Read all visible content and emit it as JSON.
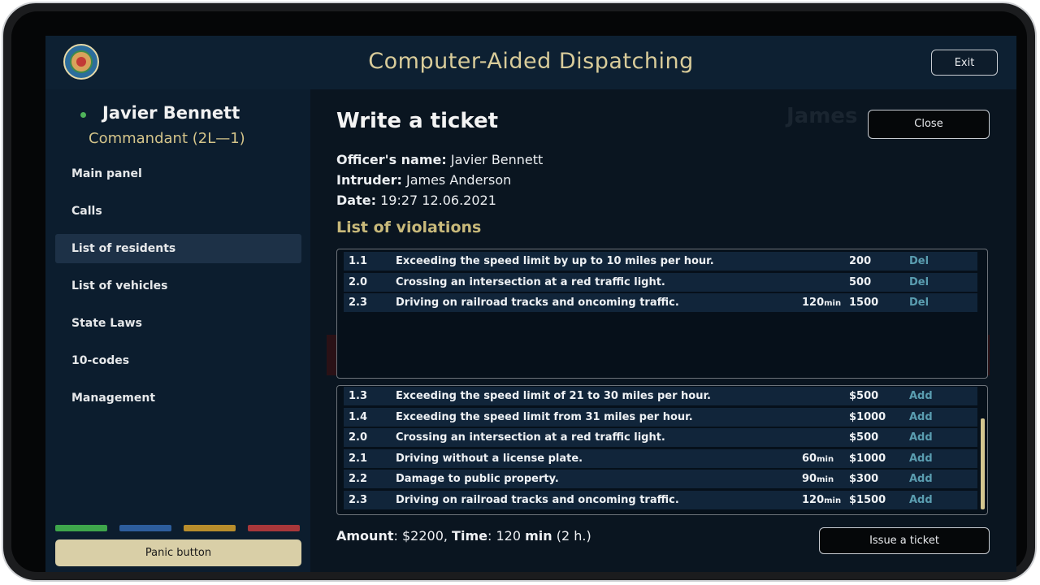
{
  "header": {
    "title": "Computer-Aided Dispatching",
    "exit_label": "Exit"
  },
  "user": {
    "name": "Javier Bennett",
    "role": "Commandant (2L—1)",
    "status_color": "#4fb35a"
  },
  "sidebar": {
    "items": [
      {
        "label": "Main panel",
        "active": false
      },
      {
        "label": "Calls",
        "active": false
      },
      {
        "label": "List of residents",
        "active": true
      },
      {
        "label": "List of vehicles",
        "active": false
      },
      {
        "label": "State Laws",
        "active": false
      },
      {
        "label": "10-codes",
        "active": false
      },
      {
        "label": "Management",
        "active": false
      }
    ],
    "status_colors": [
      "#3ea64b",
      "#2d5d9c",
      "#b88d2c",
      "#a8373a"
    ],
    "panic_label": "Panic button"
  },
  "ticket": {
    "title": "Write a ticket",
    "close_label": "Close",
    "officer_label": "Officer's name:",
    "officer_value": "Javier Bennett",
    "intruder_label": "Intruder:",
    "intruder_value": "James Anderson",
    "date_label": "Date:",
    "date_value": "19:27 12.06.2021",
    "violations_title": "List of violations",
    "selected": [
      {
        "code": "1.1",
        "desc": "Exceeding the speed limit by up to 10 miles per hour.",
        "time": "",
        "price": "200",
        "action": "Del"
      },
      {
        "code": "2.0",
        "desc": "Crossing an intersection at a red traffic light.",
        "time": "",
        "price": "500",
        "action": "Del"
      },
      {
        "code": "2.3",
        "desc": "Driving on railroad tracks and oncoming traffic.",
        "time": "120",
        "price": "1500",
        "action": "Del"
      }
    ],
    "available": [
      {
        "code": "1.3",
        "desc": "Exceeding the speed limit of 21 to 30 miles per hour.",
        "time": "",
        "price": "$500",
        "action": "Add"
      },
      {
        "code": "1.4",
        "desc": "Exceeding the speed limit from 31 miles per hour.",
        "time": "",
        "price": "$1000",
        "action": "Add"
      },
      {
        "code": "2.0",
        "desc": "Crossing an intersection at a red traffic light.",
        "time": "",
        "price": "$500",
        "action": "Add"
      },
      {
        "code": "2.1",
        "desc": "Driving without a license plate.",
        "time": "60",
        "price": "$1000",
        "action": "Add"
      },
      {
        "code": "2.2",
        "desc": "Damage to public property.",
        "time": "90",
        "price": "$300",
        "action": "Add"
      },
      {
        "code": "2.3",
        "desc": "Driving on railroad tracks and oncoming traffic.",
        "time": "120",
        "price": "$1500",
        "action": "Add"
      }
    ],
    "time_unit": "min",
    "amount_label": "Amount",
    "amount_value": "$2200",
    "time_label": "Time",
    "time_value": "120",
    "time_value_unit": "min",
    "time_hours": "(2 h.)",
    "issue_label": "Issue a ticket"
  },
  "background": {
    "ghost_name": "James"
  }
}
